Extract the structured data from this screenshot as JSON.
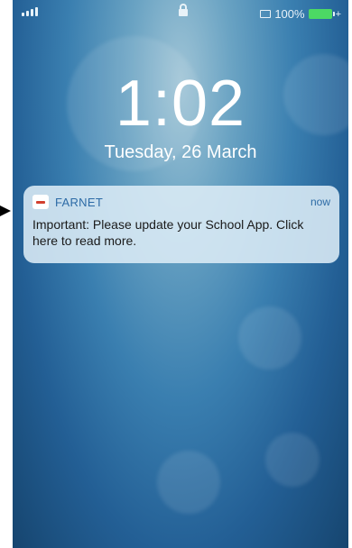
{
  "status_bar": {
    "battery": "100%"
  },
  "lock_screen": {
    "time": "1:02",
    "date": "Tuesday, 26 March"
  },
  "notification": {
    "app_name": "FARNET",
    "time": "now",
    "message": "Important: Please update your School App. Click here to read more."
  },
  "colors": {
    "accent": "#2d6ba6",
    "battery": "#4cd964"
  },
  "icons": [
    "signal-icon",
    "lock-icon",
    "airplay-icon",
    "battery-icon",
    "charging-icon",
    "app-icon",
    "arrow-icon"
  ]
}
